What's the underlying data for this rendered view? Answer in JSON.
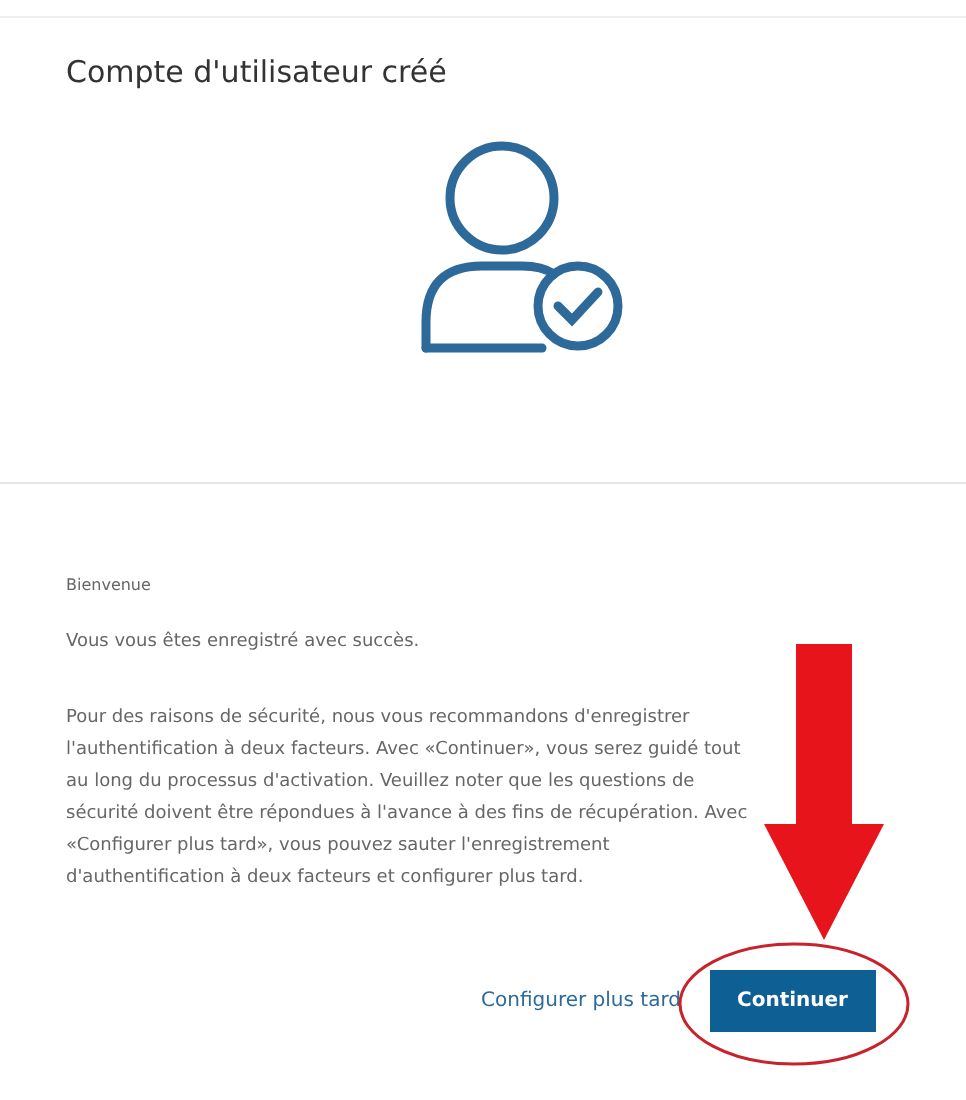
{
  "header": {
    "title": "Compte d'utilisateur créé"
  },
  "body": {
    "heading": "Bienvenue",
    "success": "Vous vous êtes enregistré avec succès.",
    "paragraph": "Pour des raisons de sécurité, nous vous recommandons d'enregistrer l'authentification à deux facteurs. Avec «Continuer», vous serez guidé tout au long du processus d'activation. Veuillez noter que les questions de sécurité doivent être répondues à l'avance à des fins de récupération. Avec «Configurer plus tard», vous pouvez sauter l'enregistrement d'authentification à deux facteurs et configurer plus tard."
  },
  "buttons": [
    {
      "kind": "link",
      "label": "Configurer plus tard"
    },
    {
      "kind": "primary",
      "label": "Continuer"
    }
  ]
}
